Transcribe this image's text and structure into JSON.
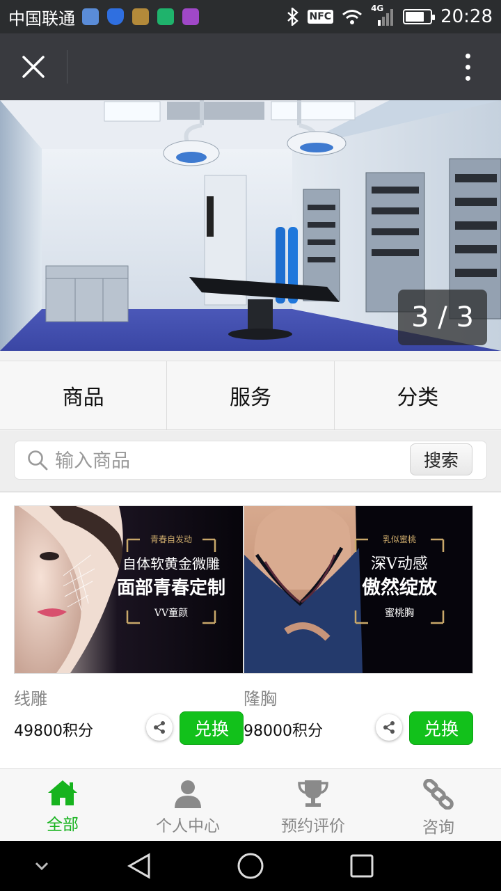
{
  "status_bar": {
    "carrier": "中国联通",
    "network": "4G",
    "nfc": "NFC",
    "battery_level": 0.75,
    "time": "20:28"
  },
  "title_bar": {
    "close_icon": "close-icon",
    "menu_icon": "more-vertical-icon"
  },
  "banner": {
    "slide_current": "3",
    "slide_total": "3",
    "slide_counter": "3 / 3"
  },
  "tabs": [
    {
      "label": "商品"
    },
    {
      "label": "服务"
    },
    {
      "label": "分类"
    }
  ],
  "search": {
    "placeholder": "输入商品",
    "value": "",
    "button_label": "搜索"
  },
  "products": [
    {
      "name": "线雕",
      "price": "49800积分",
      "redeem_label": "兑换",
      "image_text": {
        "line1": "青春自发动",
        "line2": "自体软黄金微雕",
        "line3": "面部青春定制",
        "line4": "VV童颜"
      }
    },
    {
      "name": "隆胸",
      "price": "98000积分",
      "redeem_label": "兑换",
      "image_text": {
        "line1": "乳似蜜桃",
        "line2": "深V动感",
        "line3": "傲然绽放",
        "line4": "蜜桃胸"
      }
    }
  ],
  "bottom_nav": [
    {
      "label": "全部",
      "icon": "home-icon",
      "active": true
    },
    {
      "label": "个人中心",
      "icon": "user-icon",
      "active": false
    },
    {
      "label": "预约评价",
      "icon": "trophy-icon",
      "active": false
    },
    {
      "label": "咨询",
      "icon": "link-icon",
      "active": false
    }
  ],
  "colors": {
    "accent_green": "#12c11b",
    "status_bar": "#2b2d2f",
    "title_bar": "#393a3f",
    "gold": "#c9a86a"
  }
}
